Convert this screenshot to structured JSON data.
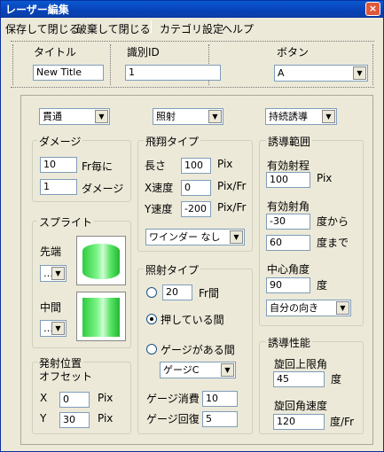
{
  "window": {
    "title": "レーザー編集",
    "close_glyph": "×"
  },
  "menu": {
    "save_close": "保存して閉じる",
    "discard_close": "破棄して閉じる",
    "category": "カテゴリ設定",
    "help": "ヘルプ"
  },
  "header": {
    "title_label": "タイトル",
    "title_value": "New Title",
    "id_label": "識別ID",
    "id_value": "1",
    "button_label": "ボタン",
    "button_value": "A"
  },
  "top_combos": {
    "pierce": "貫通",
    "fire": "照射",
    "guide": "持続誘導"
  },
  "damage": {
    "label": "ダメージ",
    "frames": "10",
    "frames_unit": "Fr毎に",
    "amount": "1",
    "amount_unit": "ダメージ"
  },
  "sprite": {
    "label": "スプライト",
    "head_label": "先端",
    "head_value": "…",
    "mid_label": "中間",
    "mid_value": "…"
  },
  "launch": {
    "label": "発射位置",
    "offset_label": "オフセット",
    "x_label": "X",
    "x_value": "0",
    "x_unit": "Pix",
    "y_label": "Y",
    "y_value": "30",
    "y_unit": "Pix"
  },
  "flight": {
    "label": "飛翔タイプ",
    "length_label": "長さ",
    "length_value": "100",
    "length_unit": "Pix",
    "xspeed_label": "X速度",
    "xspeed_value": "0",
    "xspeed_unit": "Pix/Fr",
    "yspeed_label": "Y速度",
    "yspeed_value": "-200",
    "yspeed_unit": "Pix/Fr",
    "winder": "ワインダー なし"
  },
  "firetype": {
    "label": "照射タイプ",
    "frames_value": "20",
    "frames_unit": "Fr間",
    "press_label": "押している間",
    "gauge_label": "ゲージがある間",
    "gauge_combo": "ゲージC",
    "consume_label": "ゲージ消費",
    "consume_value": "10",
    "recover_label": "ゲージ回復",
    "recover_value": "5"
  },
  "guide_range": {
    "label": "誘導範囲",
    "range_label": "有効射程",
    "range_value": "100",
    "range_unit": "Pix",
    "angle_label": "有効射角",
    "angle_from": "-30",
    "angle_from_unit": "度から",
    "angle_to": "60",
    "angle_to_unit": "度まで",
    "center_label": "中心角度",
    "center_value": "90",
    "center_unit": "度",
    "direction": "自分の向き"
  },
  "guide_perf": {
    "label": "誘導性能",
    "limit_label": "旋回上限角",
    "limit_value": "45",
    "limit_unit": "度",
    "speed_label": "旋回角速度",
    "speed_value": "120",
    "speed_unit": "度/Fr"
  }
}
